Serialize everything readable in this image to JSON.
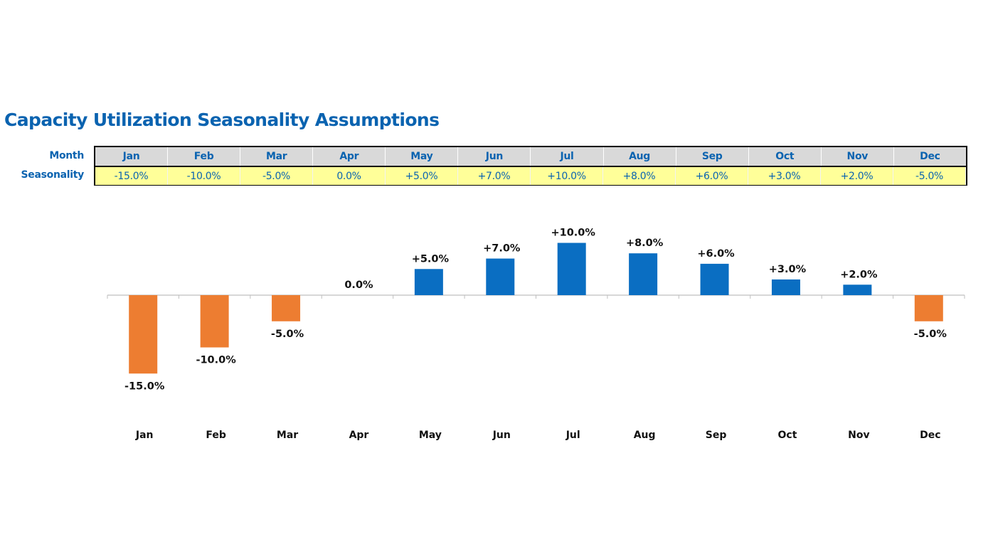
{
  "title": "Capacity Utilization Seasonality Assumptions",
  "table": {
    "row_labels": {
      "month": "Month",
      "seasonality": "Seasonality"
    },
    "months": [
      "Jan",
      "Feb",
      "Mar",
      "Apr",
      "May",
      "Jun",
      "Jul",
      "Aug",
      "Sep",
      "Oct",
      "Nov",
      "Dec"
    ],
    "seasonality": [
      "-15.0%",
      "-10.0%",
      "-5.0%",
      "0.0%",
      "+5.0%",
      "+7.0%",
      "+10.0%",
      "+8.0%",
      "+6.0%",
      "+3.0%",
      "+2.0%",
      "-5.0%"
    ]
  },
  "colors": {
    "title": "#0a63b0",
    "positive_bar": "#0a6ec2",
    "negative_bar": "#ed7d31",
    "header_fill": "#d9d9d9",
    "value_fill": "#ffff99",
    "axis": "#bfbfbf"
  },
  "chart_data": {
    "type": "bar",
    "title": "",
    "xlabel": "",
    "ylabel": "",
    "categories": [
      "Jan",
      "Feb",
      "Mar",
      "Apr",
      "May",
      "Jun",
      "Jul",
      "Aug",
      "Sep",
      "Oct",
      "Nov",
      "Dec"
    ],
    "values": [
      -15.0,
      -10.0,
      -5.0,
      0.0,
      5.0,
      7.0,
      10.0,
      8.0,
      6.0,
      3.0,
      2.0,
      -5.0
    ],
    "value_unit": "%",
    "data_labels": [
      "-15.0%",
      "-10.0%",
      "-5.0%",
      "0.0%",
      "+5.0%",
      "+7.0%",
      "+10.0%",
      "+8.0%",
      "+6.0%",
      "+3.0%",
      "+2.0%",
      "-5.0%"
    ],
    "ylim": [
      -15,
      10
    ],
    "grid": false,
    "legend": "none",
    "color_rule": "positive values blue, negative values orange"
  }
}
